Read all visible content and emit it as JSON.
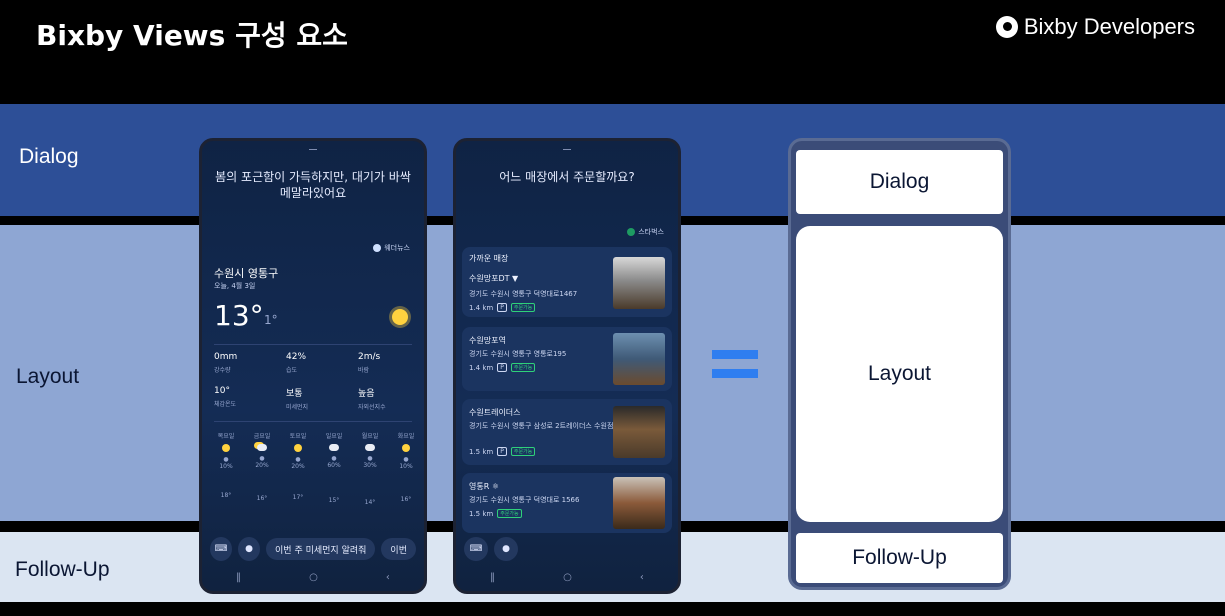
{
  "header": {
    "title": "Bixby Views 구성 요소",
    "brand": "Bixby Developers"
  },
  "bands": {
    "dialog": "Dialog",
    "layout": "Layout",
    "follow_up": "Follow-Up"
  },
  "phone_weather": {
    "dialog": "봄의 포근함이 가득하지만, 대기가 바싹 메말라있어요",
    "source": "웨더뉴스",
    "location": "수원시 영통구",
    "date": "오늘, 4월 3일",
    "temp": "13°",
    "low": "1°",
    "stats": [
      {
        "value": "0mm",
        "label": "강수량"
      },
      {
        "value": "42%",
        "label": "습도"
      },
      {
        "value": "2m/s",
        "label": "바람"
      },
      {
        "value": "10°",
        "label": "체감온도"
      },
      {
        "value": "보통",
        "label": "미세먼지"
      },
      {
        "value": "높음",
        "label": "자외선지수"
      }
    ],
    "forecast": [
      {
        "day": "목요일",
        "rain": "10%",
        "temp": "18°"
      },
      {
        "day": "금요일",
        "rain": "20%",
        "temp": "16°"
      },
      {
        "day": "토요일",
        "rain": "20%",
        "temp": "17°"
      },
      {
        "day": "일요일",
        "rain": "60%",
        "temp": "15°"
      },
      {
        "day": "월요일",
        "rain": "30%",
        "temp": "14°"
      },
      {
        "day": "화요일",
        "rain": "10%",
        "temp": "16°"
      }
    ],
    "followup_chips": [
      "이번 주 미세먼지 알려줘",
      "이번"
    ]
  },
  "phone_store": {
    "dialog": "어느 매장에서 주문할까요?",
    "source": "스타벅스",
    "section": "가까운 매장",
    "stores": [
      {
        "name": "수원망포DT",
        "address": "경기도 수원시 영통구 덕영대로1467",
        "distance": "1.4 km",
        "badge": "주문가능"
      },
      {
        "name": "수원망포역",
        "address": "경기도 수원시 영통구 영통로195",
        "distance": "1.4 km",
        "badge": "주문가능"
      },
      {
        "name": "수원트레이더스",
        "address": "경기도 수원시 영통구 삼성로 2트레이더스 수원점",
        "distance": "1.5 km",
        "badge": "주문가능"
      },
      {
        "name": "영통R",
        "address": "경기도 수원시 영통구 덕영대로 1566",
        "distance": "1.5 km",
        "badge": "주문가능"
      }
    ]
  },
  "equals_sign": "=",
  "diagram": {
    "dialog": "Dialog",
    "layout": "Layout",
    "follow_up": "Follow-Up"
  },
  "colors": {
    "dialog_band": "#2d4f97",
    "layout_band": "#8ea6d3",
    "follow_band": "#dbe5f2",
    "equals": "#2f7ef0"
  }
}
